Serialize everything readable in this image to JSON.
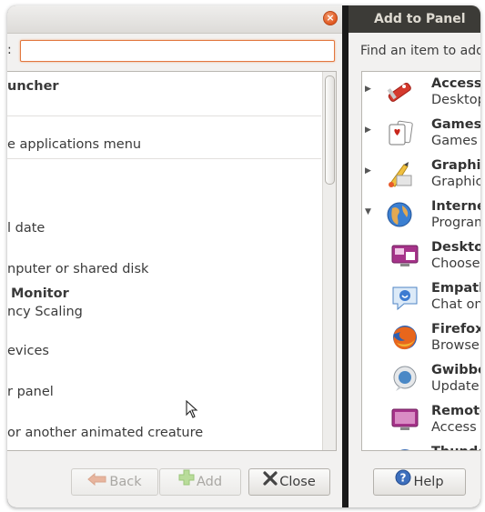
{
  "left_window": {
    "close_symbol": "×",
    "search_label": ":",
    "search_value": "",
    "items": [
      {
        "title": "uncher",
        "desc": ""
      },
      {
        "title": "",
        "desc": "e applications menu"
      },
      {
        "title": "",
        "desc": "l date"
      },
      {
        "title": "",
        "desc": "nputer or shared disk"
      },
      {
        "title": "Monitor",
        "desc": "ncy Scaling"
      },
      {
        "title": "",
        "desc": "evices"
      },
      {
        "title": "",
        "desc": "r panel"
      },
      {
        "title": "",
        "desc": "or another animated creature"
      }
    ],
    "buttons": {
      "back": "Back",
      "add": "Add",
      "close": "Close"
    }
  },
  "right_window": {
    "title": "Add to Panel",
    "find_label": "Find an item to add",
    "categories": [
      {
        "title": "Accessories",
        "desc": "Desktop accessories",
        "expander": "▶",
        "icon": "accessories-icon"
      },
      {
        "title": "Games",
        "desc": "Games and amusements",
        "expander": "▶",
        "icon": "games-icon"
      },
      {
        "title": "Graphics",
        "desc": "Graphics applications",
        "expander": "▶",
        "icon": "graphics-icon"
      },
      {
        "title": "Internet",
        "desc": "Programs for Internet access",
        "expander": "▼",
        "icon": "internet-icon"
      },
      {
        "title": "Desktop Sharing",
        "desc": "Choose how other users can view your desktop",
        "expander": "",
        "icon": "desktop-sharing-icon"
      },
      {
        "title": "Empathy",
        "desc": "Chat on Google Talk, Facebook",
        "expander": "",
        "icon": "empathy-icon"
      },
      {
        "title": "Firefox Web Browser",
        "desc": "Browse the Web",
        "expander": "",
        "icon": "firefox-icon"
      },
      {
        "title": "Gwibber",
        "desc": "Update your social networks",
        "expander": "",
        "icon": "gwibber-icon"
      },
      {
        "title": "Remote Desktop Viewer",
        "desc": "Access remote desktops",
        "expander": "",
        "icon": "remote-desktop-icon"
      },
      {
        "title": "Thunderbird",
        "desc": "",
        "expander": "",
        "icon": "thunderbird-icon"
      }
    ],
    "help_button": "Help"
  },
  "colors": {
    "accent_orange": "#e2773f",
    "window_bg": "#f2f1f0",
    "title_dark": "#3c3b37"
  }
}
